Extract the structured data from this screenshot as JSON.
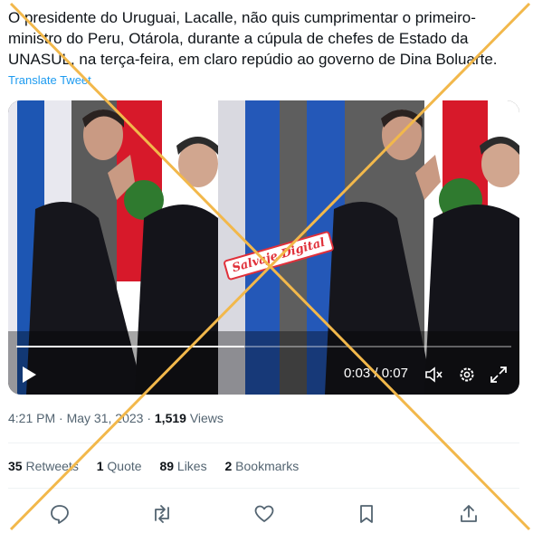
{
  "tweet": {
    "text": "O presidente do Uruguai, Lacalle, não quis cumprimentar o primeiro-ministro do Peru, Otárola, durante a cúpula de chefes de Estado da UNASUL, na terça-feira, em claro repúdio ao governo de Dina Boluarte.",
    "translate_label": "Translate Tweet"
  },
  "video": {
    "watermark": "Salvaje Digital",
    "time_current": "0:03",
    "time_separator": " / ",
    "time_total": "0:07",
    "progress": 0.46
  },
  "meta": {
    "time": "4:21 PM",
    "sep1": " · ",
    "date": "May 31, 2023",
    "sep2": " · ",
    "views_count": "1,519",
    "views_label": " Views"
  },
  "stats": {
    "retweets_count": "35",
    "retweets_label": " Retweets",
    "quotes_count": "1",
    "quotes_label": " Quote",
    "likes_count": "89",
    "likes_label": " Likes",
    "bookmarks_count": "2",
    "bookmarks_label": " Bookmarks"
  },
  "colors": {
    "link": "#1d9bf0",
    "cross_out": "#f2b84b",
    "watermark": "#e0303a"
  },
  "icons": [
    "play-icon",
    "mute-icon",
    "settings-icon",
    "fullscreen-icon",
    "reply-icon",
    "retweet-icon",
    "like-icon",
    "bookmark-icon",
    "share-icon"
  ]
}
